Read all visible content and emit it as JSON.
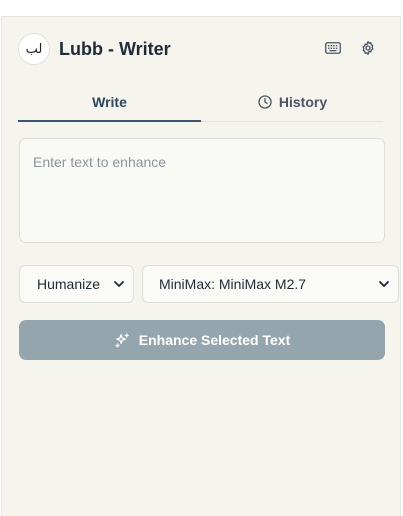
{
  "app": {
    "logo_text": "لب",
    "title": "Lubb - Writer"
  },
  "header": {
    "icons": [
      "keyboard-icon",
      "gear-icon"
    ]
  },
  "tabs": [
    {
      "label": "Write",
      "active": true
    },
    {
      "label": "History",
      "icon": "clock-icon",
      "active": false
    }
  ],
  "editor": {
    "value": "",
    "placeholder": "Enter text to enhance"
  },
  "controls": {
    "mode_selected": "Humanize",
    "model_selected": "MiniMax: MiniMax M2.7"
  },
  "enhance_button": {
    "label": "Enhance Selected Text",
    "icon": "sparkles-icon",
    "enabled": false
  },
  "colors": {
    "panel_bg": "#f5f5ee",
    "accent": "#3a5570",
    "button_disabled": "#95a5ad"
  }
}
